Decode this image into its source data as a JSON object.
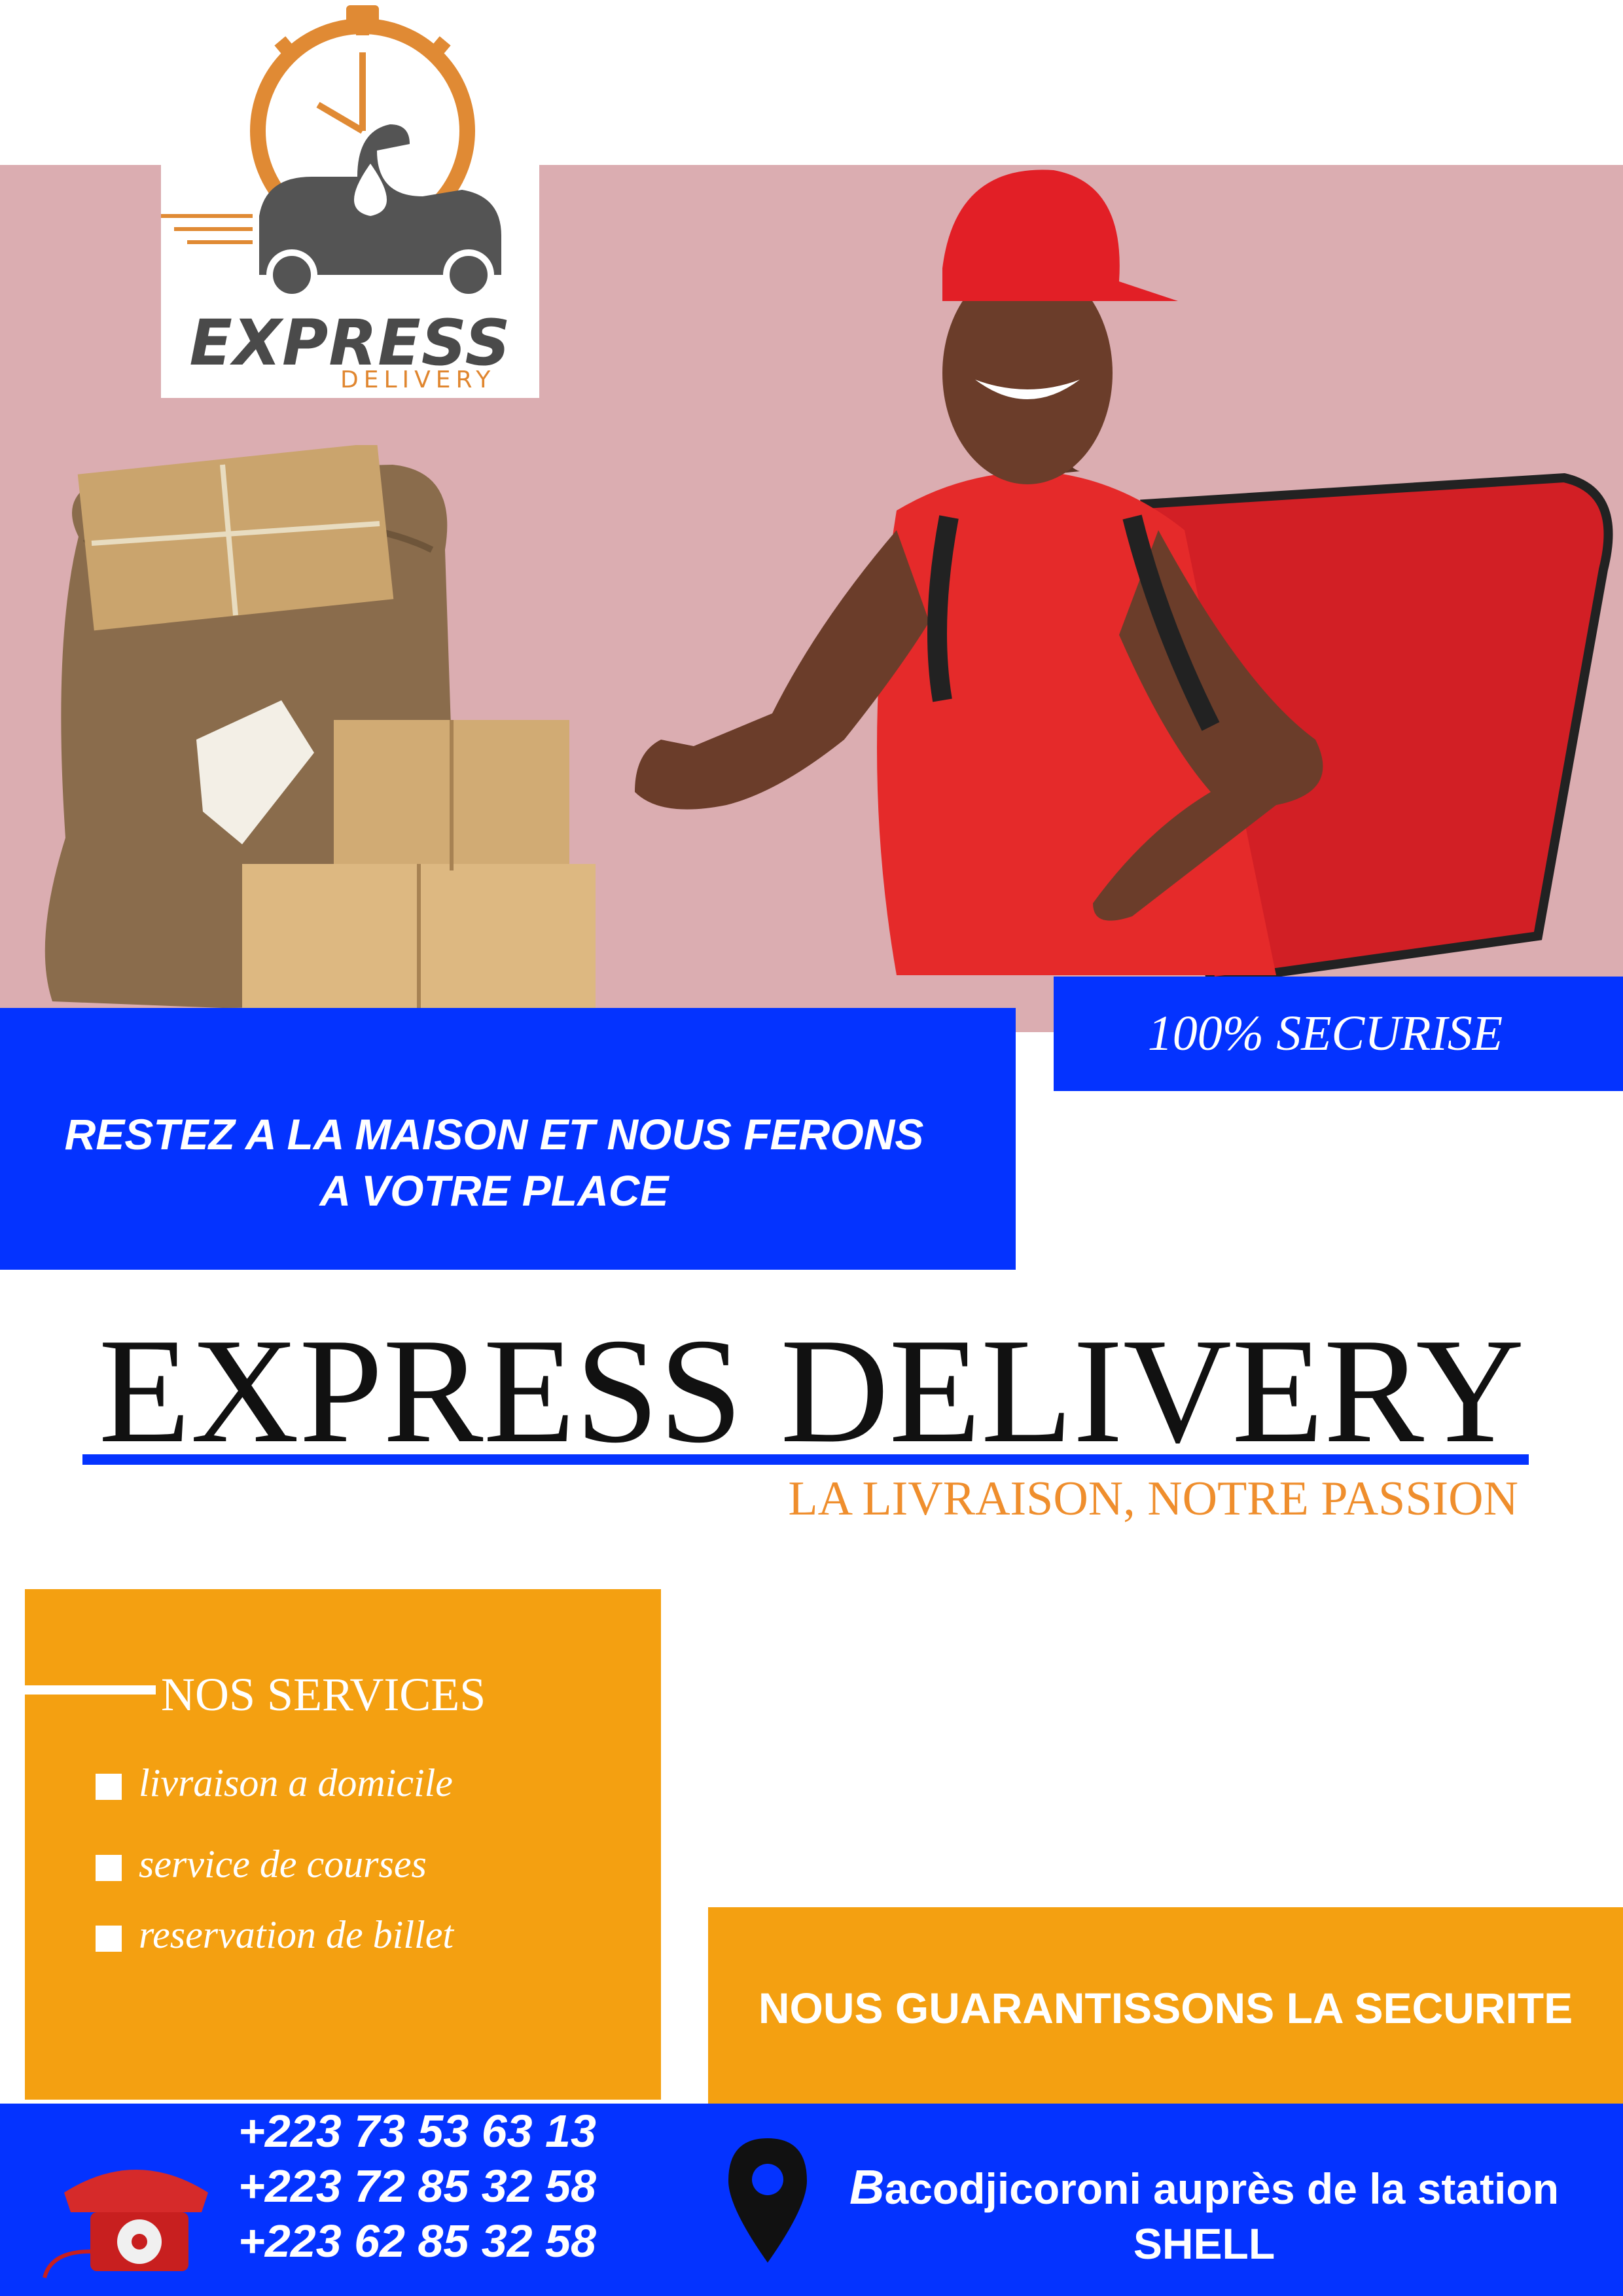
{
  "logo": {
    "title": "EXPRESS",
    "subtitle": "DELIVERY"
  },
  "badge": {
    "text": "100% SECURISE"
  },
  "slogan": {
    "line1": "RESTEZ A LA MAISON ET NOUS FERONS",
    "line2": "A VOTRE PLACE"
  },
  "heading": {
    "title": "EXPRESS DELIVERY",
    "tagline": "LA LIVRAISON, NOTRE PASSION"
  },
  "services": {
    "title": "NOS SERVICES",
    "items": [
      {
        "label": "livraison a domicile"
      },
      {
        "label": "service de courses"
      },
      {
        "label": "reservation de billet"
      }
    ]
  },
  "guarantee": {
    "text": "NOUS GUARANTISSONS LA SECURITE"
  },
  "contact": {
    "phones": [
      "+223 73 53 63 13",
      "+223 72 85 32 58",
      "+223 62 85 32 58"
    ],
    "address_first_letter": "B",
    "address_line1": "acodjicoroni auprès de la station",
    "address_line2": "SHELL"
  },
  "colors": {
    "pink": "#dbadb1",
    "blue": "#0433ff",
    "orange": "#f4a011",
    "accent_orange": "#ef8e2d"
  },
  "icons": [
    "stopwatch-scooter-logo-icon",
    "parcel-sack-image",
    "delivery-man-image",
    "telephone-icon",
    "map-pin-icon"
  ]
}
